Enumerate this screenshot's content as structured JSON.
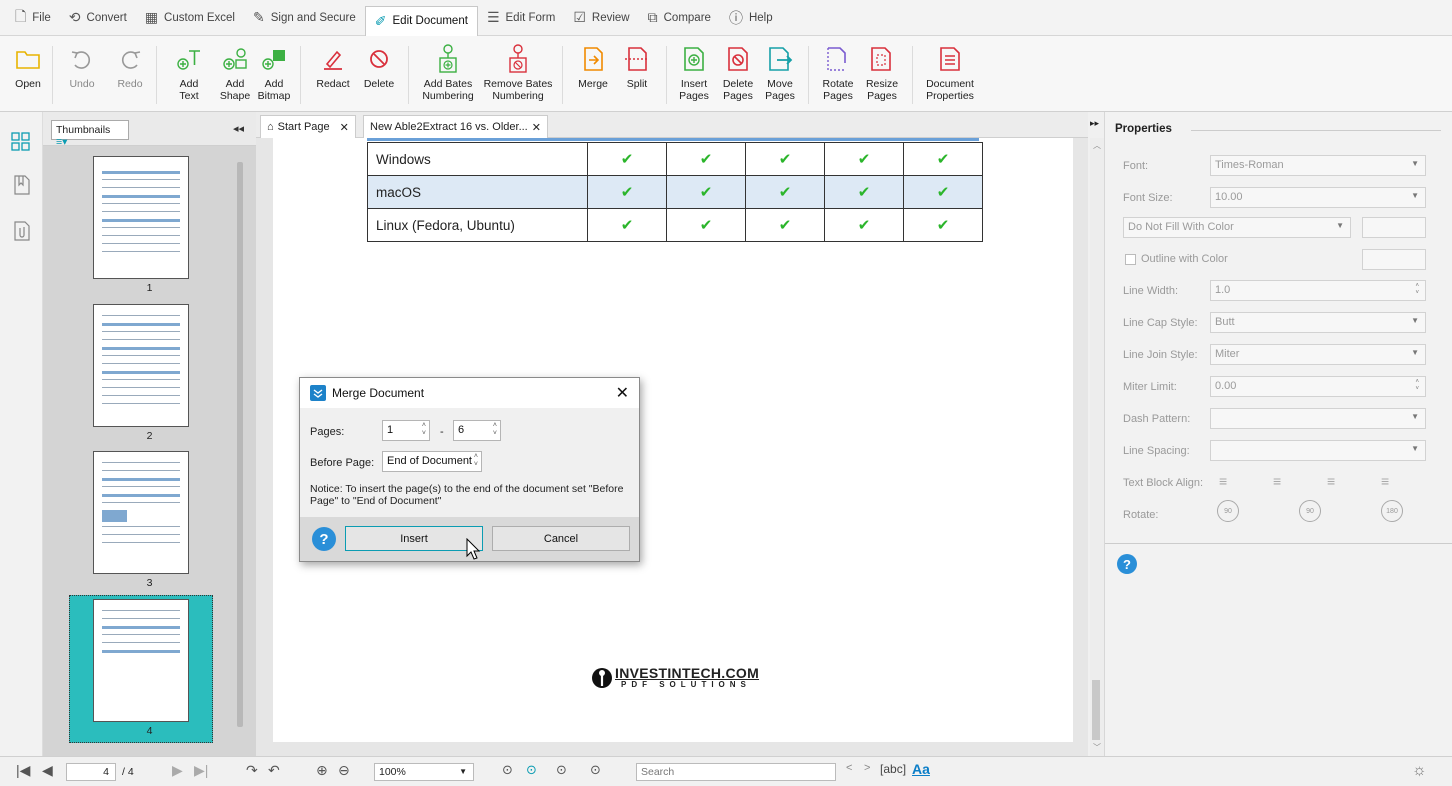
{
  "menu": [
    {
      "label": "File",
      "icon": "file-icon"
    },
    {
      "label": "Convert",
      "icon": "convert-icon"
    },
    {
      "label": "Custom Excel",
      "icon": "excel-icon"
    },
    {
      "label": "Sign and Secure",
      "icon": "sign-icon"
    },
    {
      "label": "Edit Document",
      "icon": "edit-document-icon"
    },
    {
      "label": "Edit Form",
      "icon": "edit-form-icon"
    },
    {
      "label": "Review",
      "icon": "review-icon"
    },
    {
      "label": "Compare",
      "icon": "compare-icon"
    },
    {
      "label": "Help",
      "icon": "help-icon"
    }
  ],
  "ribbon": {
    "open": "Open",
    "undo": "Undo",
    "redo": "Redo",
    "add_text": "Add\nText",
    "add_shape": "Add\nShape",
    "add_bitmap": "Add\nBitmap",
    "redact": "Redact",
    "delete": "Delete",
    "add_bates": "Add Bates\nNumbering",
    "remove_bates": "Remove Bates\nNumbering",
    "merge": "Merge",
    "split": "Split",
    "insert_pages": "Insert\nPages",
    "delete_pages": "Delete\nPages",
    "move_pages": "Move\nPages",
    "rotate_pages": "Rotate\nPages",
    "resize_pages": "Resize\nPages",
    "doc_props": "Document\nProperties"
  },
  "thumbnails": {
    "dropdown": "Thumbnails",
    "pages": [
      "1",
      "2",
      "3",
      "4"
    ]
  },
  "tabs": {
    "start": "Start Page",
    "doc": "New Able2Extract 16 vs. Older..."
  },
  "table_rows": [
    {
      "name": "Windows",
      "checks": [
        "✔",
        "✔",
        "✔",
        "✔",
        "✔"
      ],
      "alt": false
    },
    {
      "name": "macOS",
      "checks": [
        "✔",
        "✔",
        "✔",
        "✔",
        "✔"
      ],
      "alt": true
    },
    {
      "name": "Linux (Fedora, Ubuntu)",
      "checks": [
        "✔",
        "✔",
        "✔",
        "✔",
        "✔"
      ],
      "alt": false
    }
  ],
  "logo": {
    "main": "INVESTINTECH.COM",
    "sub": "PDF SOLUTIONS"
  },
  "dialog": {
    "title": "Merge Document",
    "pages_label": "Pages:",
    "from": "1",
    "dash": "-",
    "to": "6",
    "before_label": "Before Page:",
    "before_value": "End of Document",
    "notice": "Notice: To insert the page(s) to the end of the document set \"Before Page\" to \"End of Document\"",
    "insert": "Insert",
    "cancel": "Cancel"
  },
  "properties": {
    "title": "Properties",
    "font_label": "Font:",
    "font": "Times-Roman",
    "size_label": "Font Size:",
    "size": "10.00",
    "fill": "Do Not Fill With Color",
    "outline": "Outline with Color",
    "lw_label": "Line Width:",
    "lw": "1.0",
    "cap_label": "Line Cap Style:",
    "cap": "Butt",
    "join_label": "Line Join Style:",
    "join": "Miter",
    "miter_label": "Miter Limit:",
    "miter": "0.00",
    "dash_label": "Dash Pattern:",
    "dash": "",
    "spacing_label": "Line Spacing:",
    "spacing": "",
    "align_label": "Text Block Align:",
    "rotate_label": "Rotate:",
    "r1": "90",
    "r2": "90",
    "r3": "180"
  },
  "status": {
    "page": "4",
    "total": "/ 4",
    "zoom": "100%",
    "search_placeholder": "Search",
    "abc": "abc",
    "aa": "Aa"
  }
}
